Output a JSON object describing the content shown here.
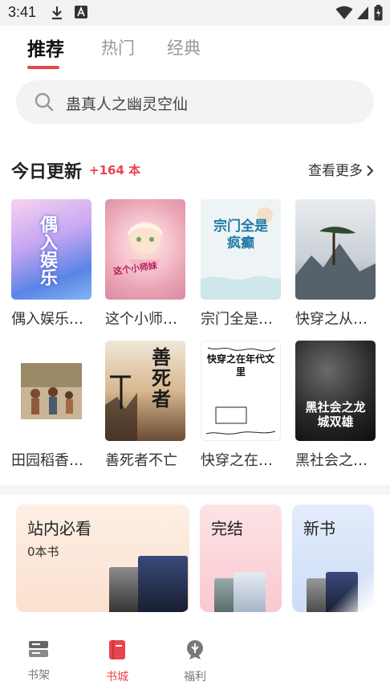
{
  "status_bar": {
    "time": "3:41"
  },
  "tabs": [
    {
      "label": "推荐"
    },
    {
      "label": "热门"
    },
    {
      "label": "经典"
    }
  ],
  "search": {
    "placeholder": "蛊真人之幽灵空仙"
  },
  "today_update": {
    "title": "今日更新",
    "count": "+164 本",
    "more_label": "查看更多"
  },
  "books": [
    {
      "title": "偶入娱乐…",
      "cover_text": "偶入娱乐"
    },
    {
      "title": "这个小师…",
      "cover_text": "这个小师妹"
    },
    {
      "title": "宗门全是…",
      "cover_text": "宗门全是疯癫"
    },
    {
      "title": "快穿之从…",
      "cover_text": ""
    },
    {
      "title": "田园稻香…",
      "cover_text": ""
    },
    {
      "title": "善死者不亡",
      "cover_text": "善死者"
    },
    {
      "title": "快穿之在…",
      "cover_text": "快穿之在年代文里"
    },
    {
      "title": "黑社会之…",
      "cover_text": "黑社会之龙城双雄"
    }
  ],
  "cards": [
    {
      "title": "站内必看",
      "subtitle": "0本书"
    },
    {
      "title": "完结"
    },
    {
      "title": "新书"
    }
  ],
  "nav": [
    {
      "label": "书架"
    },
    {
      "label": "书城"
    },
    {
      "label": "福利"
    }
  ],
  "colors": {
    "accent": "#e8454b"
  }
}
